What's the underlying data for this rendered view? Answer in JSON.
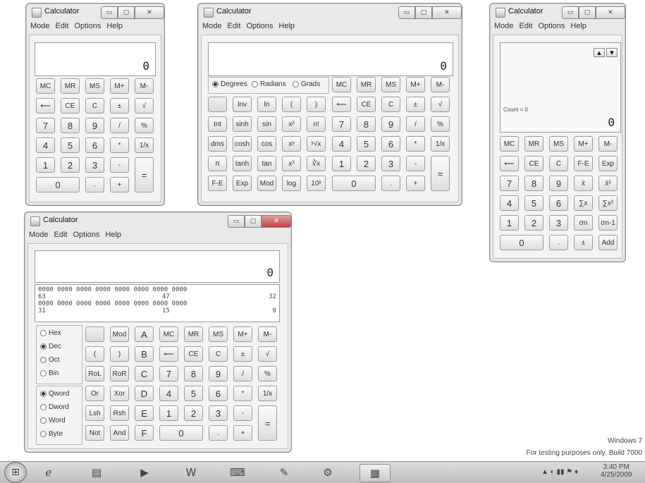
{
  "menu": [
    "Mode",
    "Edit",
    "Options",
    "Help"
  ],
  "window_title": "Calculator",
  "window_controls": {
    "minimize": "▭",
    "maximize": "▢",
    "close": "✕"
  },
  "standard": {
    "display_value": "0",
    "memory_row": [
      "MC",
      "MR",
      "MS",
      "M+",
      "M-"
    ],
    "row2": [
      "⟵",
      "CE",
      "C",
      "±",
      "√"
    ],
    "row3": [
      "7",
      "8",
      "9",
      "/",
      "%"
    ],
    "row4": [
      "4",
      "5",
      "6",
      "*",
      "1/x"
    ],
    "row5": [
      "1",
      "2",
      "3",
      "-",
      "="
    ],
    "row6": [
      "0",
      ".",
      "+"
    ]
  },
  "scientific": {
    "display_value": "0",
    "angle_options": [
      "Degrees",
      "Radians",
      "Grads"
    ],
    "angle_selected": "Degrees",
    "memory_row": [
      "MC",
      "MR",
      "MS",
      "M+",
      "M-"
    ],
    "sci_rows": [
      [
        "",
        "Inv",
        "ln",
        "(",
        ")"
      ],
      [
        "Int",
        "sinh",
        "sin",
        "x²",
        "n!"
      ],
      [
        "dms",
        "cosh",
        "cos",
        "xʸ",
        "ʸ√x"
      ],
      [
        "π",
        "tanh",
        "tan",
        "x³",
        "∛x"
      ],
      [
        "F-E",
        "Exp",
        "Mod",
        "log",
        "10ˣ"
      ]
    ],
    "num_rows": [
      [
        "⟵",
        "CE",
        "C",
        "±",
        "√"
      ],
      [
        "7",
        "8",
        "9",
        "/",
        "%"
      ],
      [
        "4",
        "5",
        "6",
        "*",
        "1/x"
      ],
      [
        "1",
        "2",
        "3",
        "-",
        "="
      ],
      [
        "0",
        ".",
        "+"
      ]
    ]
  },
  "statistics": {
    "display_value": "0",
    "count_label": "Count = 0",
    "scroll_up": "▲",
    "scroll_down": "▼",
    "rows": [
      [
        "MC",
        "MR",
        "MS",
        "M+",
        "M-"
      ],
      [
        "⟵",
        "CE",
        "C",
        "F-E",
        "Exp"
      ],
      [
        "7",
        "8",
        "9",
        "x̄",
        "x̄²"
      ],
      [
        "4",
        "5",
        "6",
        "∑x",
        "∑x²"
      ],
      [
        "1",
        "2",
        "3",
        "σn",
        "σn-1"
      ],
      [
        "0",
        ".",
        "±",
        "Add"
      ]
    ]
  },
  "programmer": {
    "display_value": "0",
    "bits_line1": "0000  0000  0000  0000  0000  0000  0000  0000",
    "bits_marks1": [
      "63",
      "47",
      "32"
    ],
    "bits_line2": "0000  0000  0000  0000  0000  0000  0000  0000",
    "bits_marks2": [
      "31",
      "15",
      "0"
    ],
    "base_options": [
      "Hex",
      "Dec",
      "Oct",
      "Bin"
    ],
    "base_selected": "Dec",
    "word_options": [
      "Qword",
      "Dword",
      "Word",
      "Byte"
    ],
    "word_selected": "Qword",
    "col1": [
      "",
      "(",
      "RoL",
      "Or",
      "Lsh",
      "Not"
    ],
    "col2": [
      "Mod",
      ")",
      "RoR",
      "Xor",
      "Rsh",
      "And"
    ],
    "col3": [
      "A",
      "B",
      "C",
      "D",
      "E",
      "F"
    ],
    "num_rows": [
      [
        "MC",
        "MR",
        "MS",
        "M+",
        "M-"
      ],
      [
        "⟵",
        "CE",
        "C",
        "±",
        "√"
      ],
      [
        "7",
        "8",
        "9",
        "/",
        "%"
      ],
      [
        "4",
        "5",
        "6",
        "*",
        "1/x"
      ],
      [
        "1",
        "2",
        "3",
        "-",
        "="
      ],
      [
        "0",
        ".",
        "+"
      ]
    ]
  },
  "watermark": {
    "line1": "Windows 7",
    "line2": "For testing purposes only. Build 7000"
  },
  "tray": {
    "time": "3:40 PM",
    "date": "4/25/2009"
  }
}
